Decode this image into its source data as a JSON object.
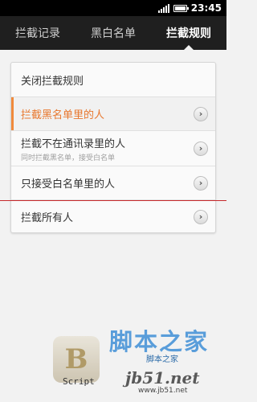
{
  "status_bar": {
    "time": "23:45"
  },
  "tabs": [
    {
      "label": "拦截记录",
      "active": false
    },
    {
      "label": "黑白名单",
      "active": false
    },
    {
      "label": "拦截规则",
      "active": true
    }
  ],
  "rules": [
    {
      "label": "关闭拦截规则",
      "subtitle": "",
      "has_arrow": false,
      "selected": false
    },
    {
      "label": "拦截黑名单里的人",
      "subtitle": "",
      "has_arrow": true,
      "selected": true
    },
    {
      "label": "拦截不在通讯录里的人",
      "subtitle": "同时拦截黑名单，接受白名单",
      "has_arrow": true,
      "selected": false
    },
    {
      "label": "只接受白名单里的人",
      "subtitle": "",
      "has_arrow": true,
      "selected": false
    },
    {
      "label": "拦截所有人",
      "subtitle": "",
      "has_arrow": true,
      "selected": false
    }
  ],
  "watermark": {
    "logo_text": "Script",
    "cn_text": "脚本之家",
    "site_text": "脚本之家",
    "domain": "jb51.net",
    "url": "www.jb51.net"
  },
  "colors": {
    "accent": "#e8772e",
    "tab_bar": "#1f1f1f",
    "background": "#f2f2f2"
  },
  "icons": {
    "arrow": "chevron-right-icon",
    "battery": "battery-icon",
    "signal": "signal-icon"
  }
}
